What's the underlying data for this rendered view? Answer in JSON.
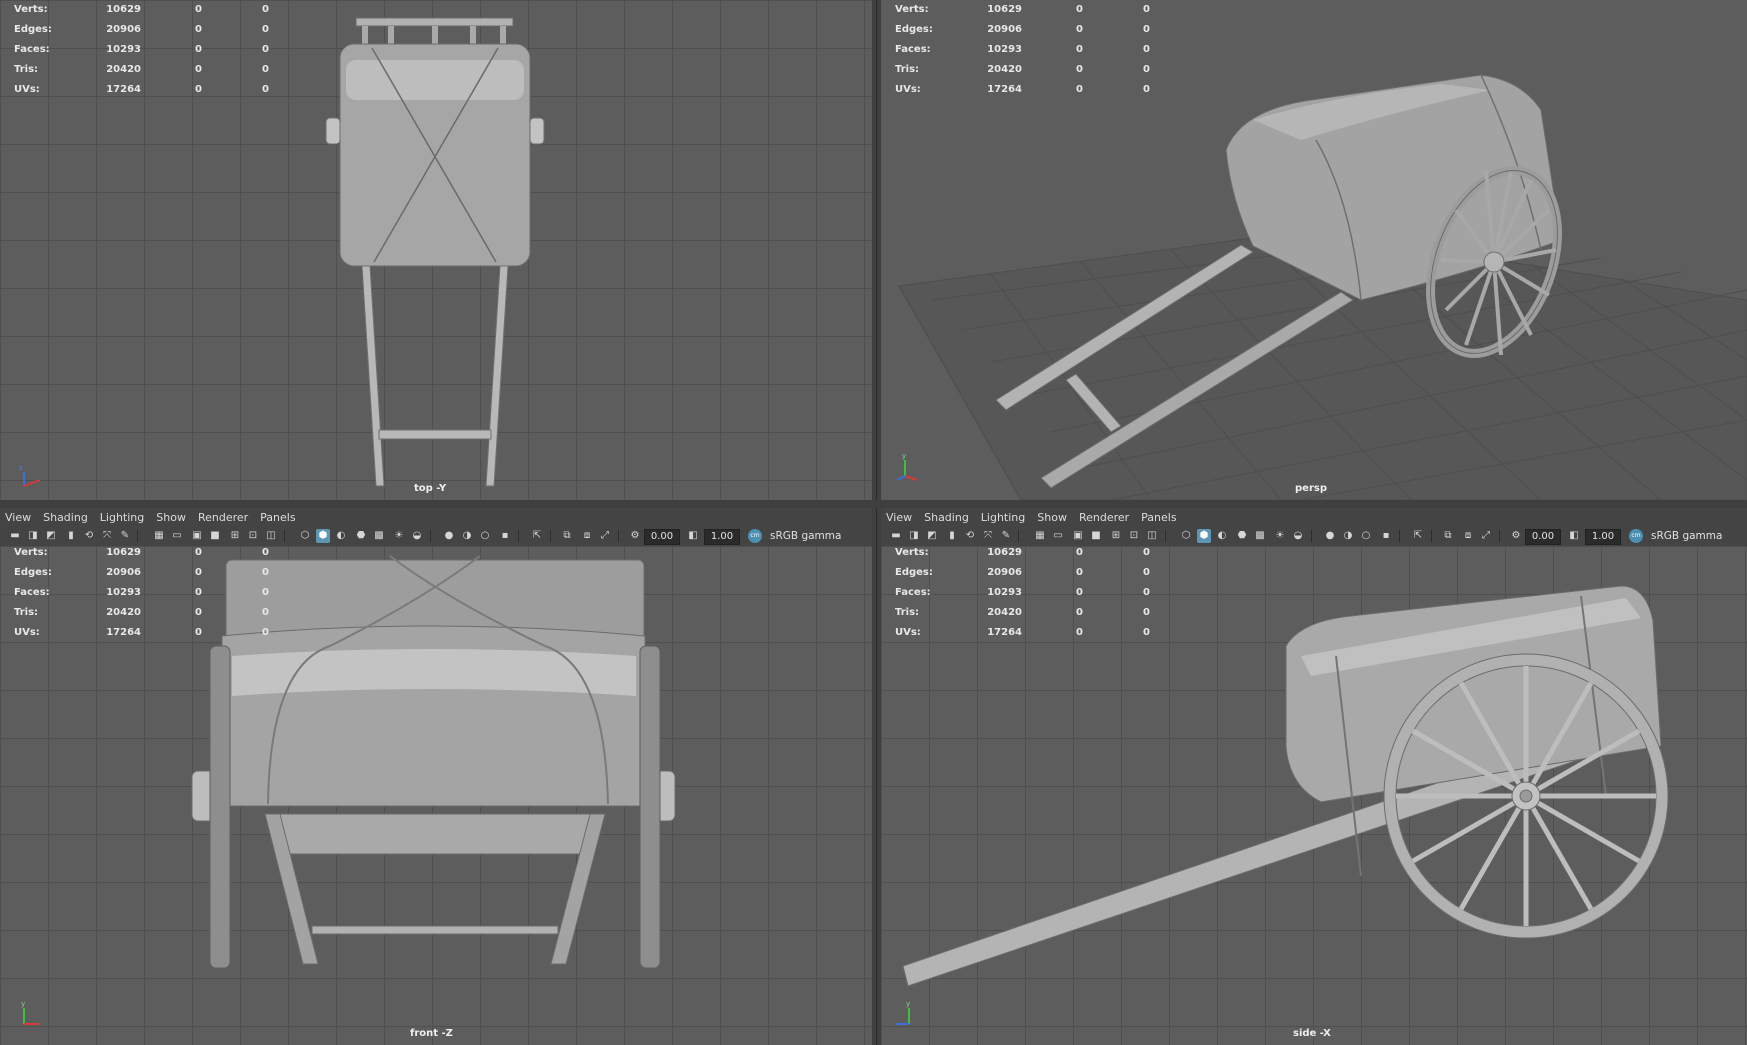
{
  "hud": {
    "verts_label": "Verts:",
    "verts": "10629",
    "edges_label": "Edges:",
    "edges": "20906",
    "faces_label": "Faces:",
    "faces": "10293",
    "tris_label": "Tris:",
    "tris": "20420",
    "uvs_label": "UVs:",
    "uvs": "17264",
    "zero": "0"
  },
  "viewports": {
    "top": {
      "camera": "top -Y"
    },
    "persp": {
      "camera": "persp"
    },
    "front": {
      "camera": "front -Z"
    },
    "side": {
      "camera": "side -X"
    }
  },
  "menu": {
    "view": "View",
    "shading": "Shading",
    "lighting": "Lighting",
    "show": "Show",
    "renderer": "Renderer",
    "panels": "Panels"
  },
  "toolbar": {
    "exposure": "0.00",
    "gamma_value": "1.00",
    "color_space": "sRGB gamma",
    "gamma_icon_text": "cm"
  },
  "colors": {
    "viewport_bg": "#5d5d5d",
    "grid_line": "#4f4f4f",
    "ui_bg": "#444444",
    "active_icon": "#5d96b3",
    "model_gray": "#a8a8a8"
  },
  "icons": [
    "camera-icon",
    "camera-attributes-icon",
    "bookmark-icon",
    "image-plane-icon",
    "grease-pencil-icon",
    "grid-icon",
    "film-gate-icon",
    "resolution-gate-icon",
    "safe-action-icon",
    "wireframe-icon",
    "smooth-shade-icon",
    "lighting-icon",
    "shadows-icon",
    "textured-icon",
    "isolate-select-icon",
    "xray-icon",
    "ambient-occlusion-icon",
    "motion-blur-icon",
    "exposure-icon",
    "gamma-icon"
  ]
}
